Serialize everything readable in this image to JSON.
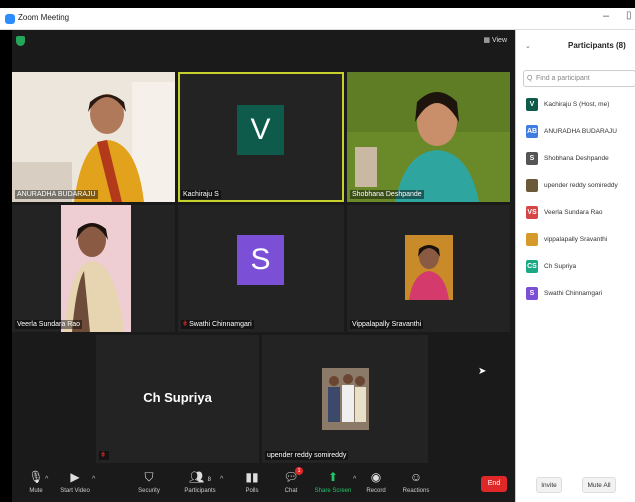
{
  "window": {
    "title": "Zoom Meeting"
  },
  "topbar": {
    "view_label": "View"
  },
  "tiles": [
    {
      "name": "ANURADHA BUDARAJU",
      "type": "video"
    },
    {
      "name": "Kachiraju S",
      "type": "avatar",
      "initial": "V",
      "avatar_color": "#0e5a4b",
      "active": true
    },
    {
      "name": "Shobhana Deshpande",
      "type": "video"
    },
    {
      "name": "Veerla Sundara Rao",
      "type": "video"
    },
    {
      "name": "Swathi Chinnamgari",
      "type": "avatar",
      "initial": "S",
      "avatar_color": "#7b4fd6",
      "muted": true
    },
    {
      "name": "Vippalapally Sravanthi",
      "type": "video"
    },
    {
      "name": "Ch Supriya",
      "type": "name_only",
      "muted": true
    },
    {
      "name": "upender reddy somireddy",
      "type": "video"
    }
  ],
  "toolbar": {
    "mute": "Mute",
    "start_video": "Start Video",
    "security": "Security",
    "participants": "Participants",
    "participants_count": "8",
    "polls": "Polls",
    "chat": "Chat",
    "chat_badge": "1",
    "share_screen": "Share Screen",
    "record": "Record",
    "reactions": "Reactions",
    "end": "End"
  },
  "panel": {
    "title": "Participants (8)",
    "search_placeholder": "Find a participant",
    "participants": [
      {
        "initials": "V",
        "name": "Kachiraju S (Host, me)",
        "color": "#0e5a4b"
      },
      {
        "initials": "AB",
        "name": "ANURADHA BUDARAJU",
        "color": "#3f7be0"
      },
      {
        "initials": "S",
        "name": "Shobhana Deshpande",
        "color": "#555555"
      },
      {
        "initials": "",
        "name": "upender reddy somireddy",
        "color": "#6b5a3a"
      },
      {
        "initials": "VS",
        "name": "Veerla Sundara Rao",
        "color": "#d64545"
      },
      {
        "initials": "",
        "name": "vippalapally Sravanthi",
        "color": "#d69a2a"
      },
      {
        "initials": "CS",
        "name": "Ch Supriya",
        "color": "#1aa885"
      },
      {
        "initials": "S",
        "name": "Swathi Chinnamgari",
        "color": "#7b4fd6"
      }
    ],
    "invite": "Invite",
    "mute_all": "Mute All"
  },
  "colors": {
    "active_speaker": "#c6d12b",
    "end_button": "#e02828",
    "share_green": "#23c36b"
  }
}
